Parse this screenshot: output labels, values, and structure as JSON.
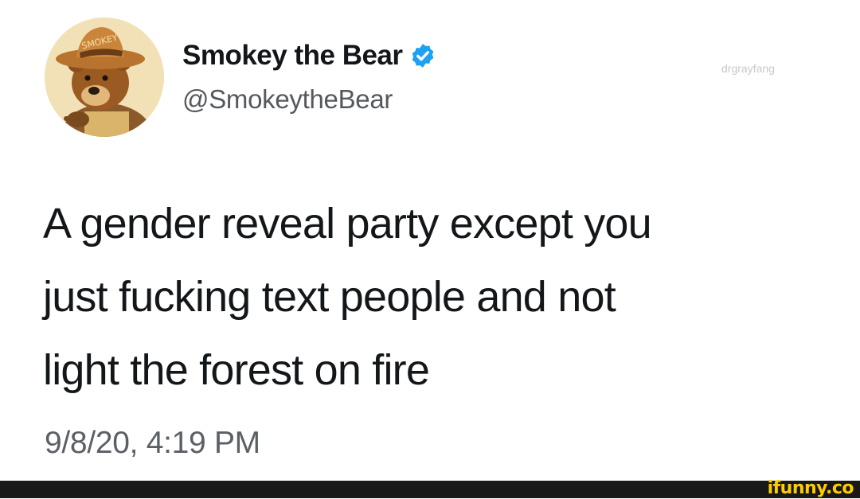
{
  "tweet": {
    "display_name": "Smokey the Bear",
    "handle": "@SmokeytheBear",
    "verified": true,
    "avatar_hat_text": "SMOKEY",
    "text": "A gender reveal party except you just fucking text people and not light the forest on fire",
    "text_lines": [
      "A gender reveal party except you",
      "just fucking text people and not",
      "light the forest on fire"
    ],
    "timestamp": "9/8/20, 4:19 PM"
  },
  "watermark": "drgrayfang",
  "footer": {
    "logo": "ifunny.co",
    "accent_color": "#ffcc00"
  },
  "colors": {
    "verified_badge": "#1da1f2",
    "text": "#14171a",
    "secondary_text": "#5b6066"
  }
}
